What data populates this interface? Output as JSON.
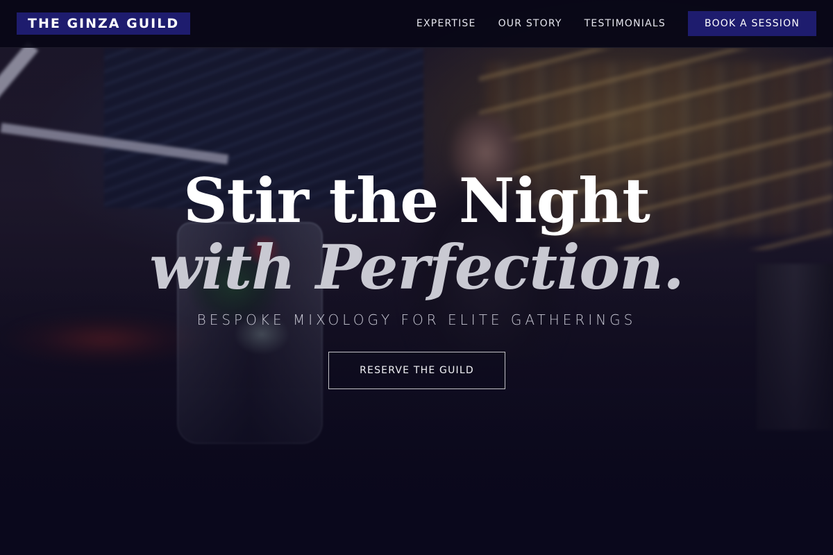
{
  "header": {
    "brand": "THE GINZA GUILD",
    "nav": [
      {
        "label": "EXPERTISE"
      },
      {
        "label": "OUR STORY"
      },
      {
        "label": "TESTIMONIALS"
      }
    ],
    "cta_label": "BOOK A SESSION"
  },
  "hero": {
    "headline_line1": "Stir the Night",
    "headline_line2": "with Perfection.",
    "tagline": "BESPOKE MIXOLOGY FOR ELITE GATHERINGS",
    "button_label": "RESERVE THE GUILD"
  },
  "colors": {
    "brand_indigo": "#1e1c6e",
    "header_bg": "#08071a",
    "page_bg": "#0c0a1c",
    "headline_primary": "#ffffff",
    "headline_secondary": "#c9c9d2"
  }
}
